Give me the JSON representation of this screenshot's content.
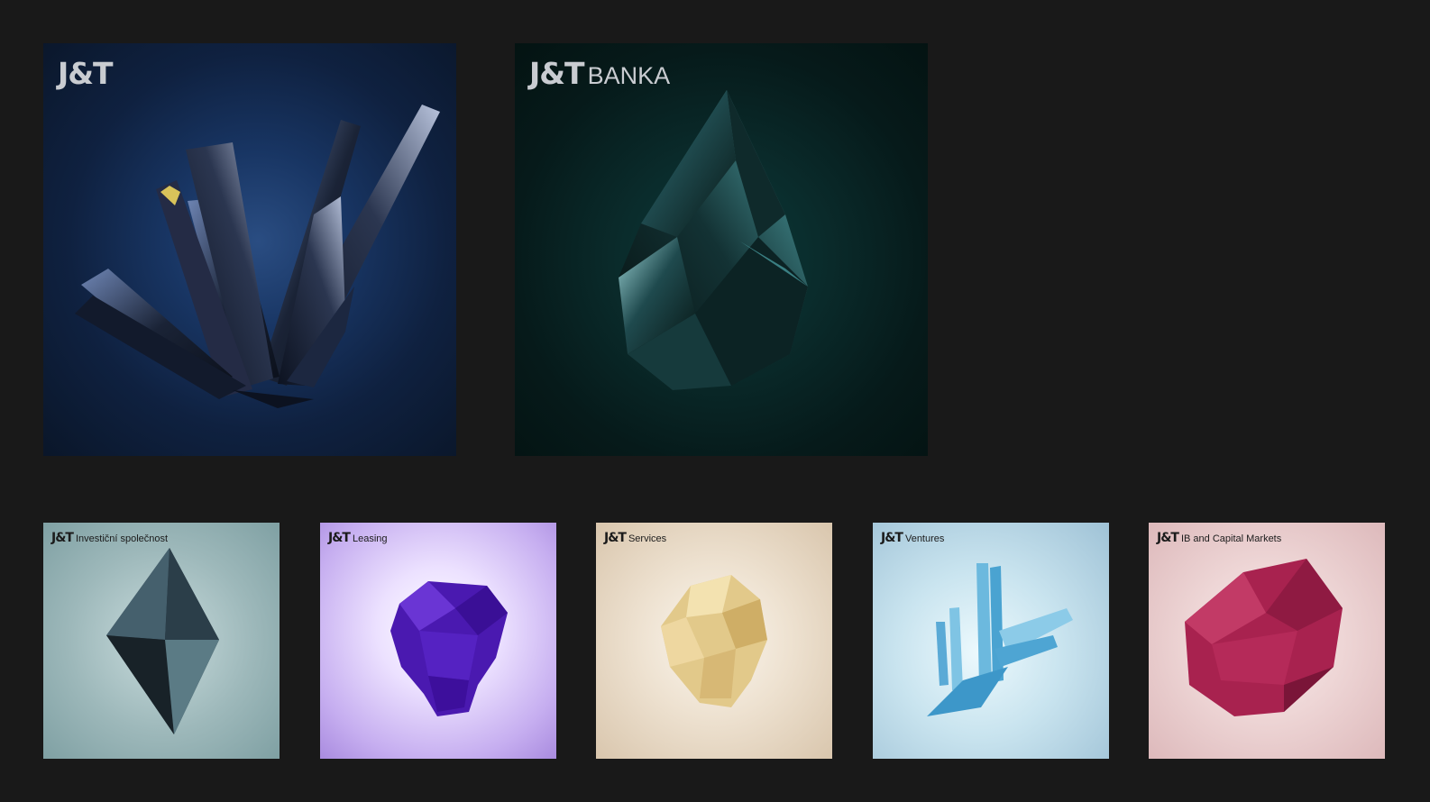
{
  "cards_large": [
    {
      "brand_mark": "J&T",
      "division": ""
    },
    {
      "brand_mark": "J&T",
      "division": "BANKA"
    }
  ],
  "cards_small": [
    {
      "brand_mark": "J&T",
      "division": "Investiční společnost"
    },
    {
      "brand_mark": "J&T",
      "division": "Leasing"
    },
    {
      "brand_mark": "J&T",
      "division": "Services"
    },
    {
      "brand_mark": "J&T",
      "division": "Ventures"
    },
    {
      "brand_mark": "J&T",
      "division": "IB and Capital Markets"
    }
  ],
  "colors": {
    "page_background": "#191919",
    "jt_card": "#183563",
    "banka_card": "#0a2b2b",
    "investicni_card": "#9db8ba",
    "leasing_card": "#d9c9fb",
    "services_card": "#eee2d1",
    "ventures_card": "#c9e4ef",
    "ib_card": "#eed6d6"
  }
}
